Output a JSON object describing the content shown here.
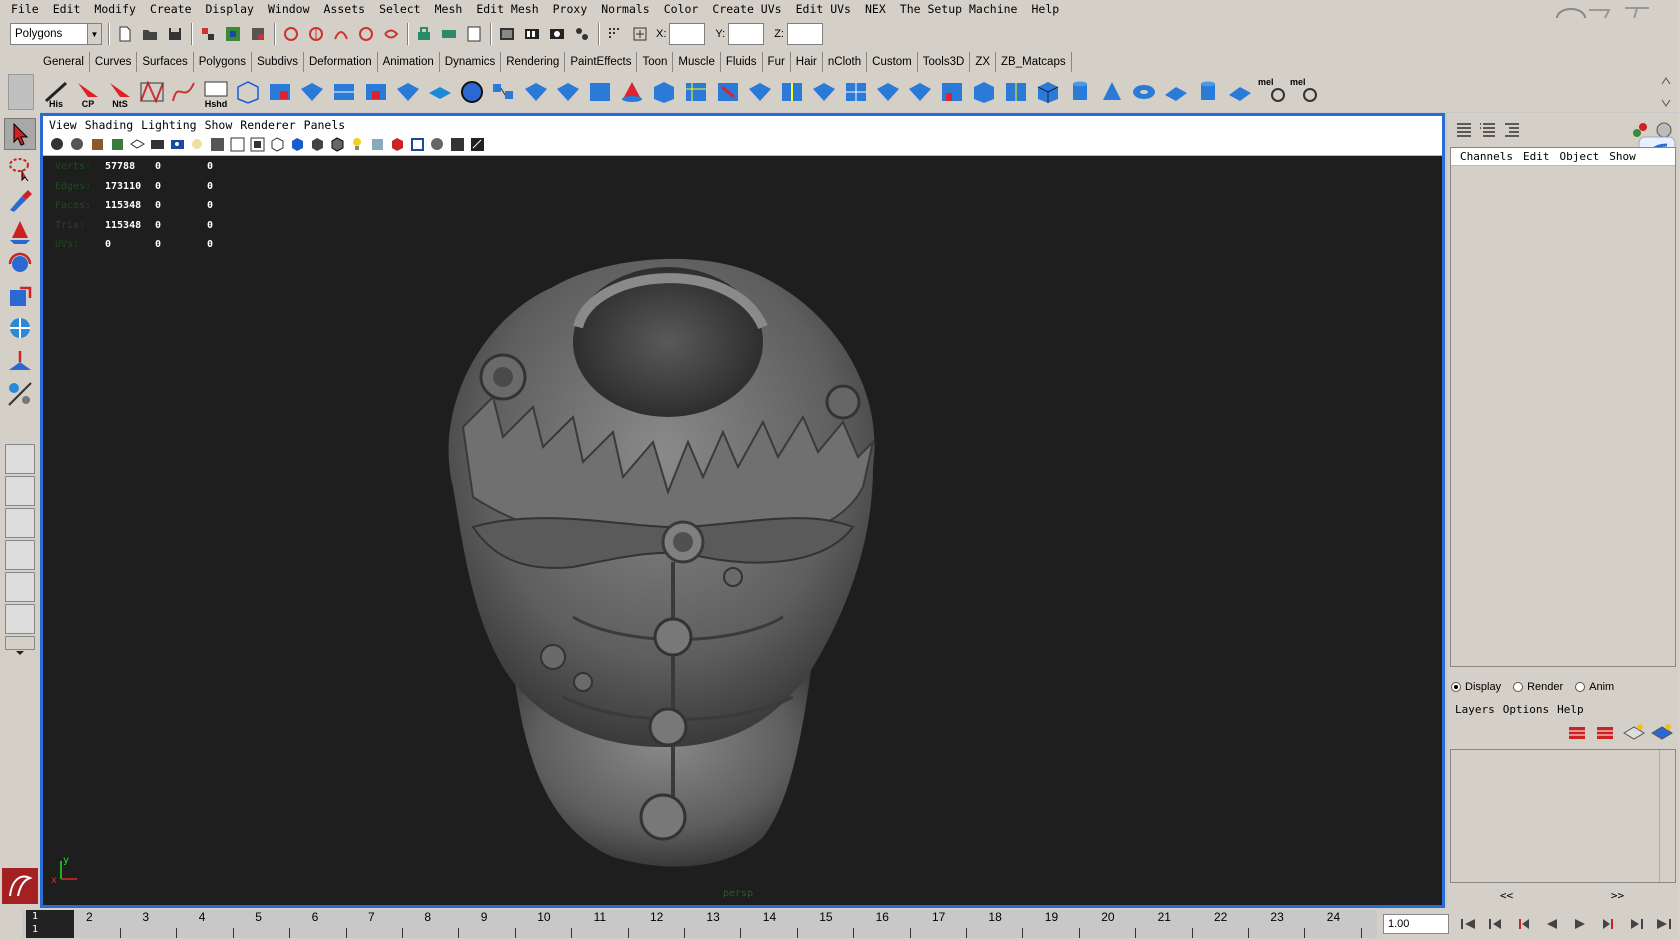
{
  "menubar": [
    "File",
    "Edit",
    "Modify",
    "Create",
    "Display",
    "Window",
    "Assets",
    "Select",
    "Mesh",
    "Edit Mesh",
    "Proxy",
    "Normals",
    "Color",
    "Create UVs",
    "Edit UVs",
    "NEX",
    "The Setup Machine",
    "Help"
  ],
  "status": {
    "mode": "Polygons",
    "x_label": "X:",
    "y_label": "Y:",
    "z_label": "Z:"
  },
  "shelf_tabs": [
    "General",
    "Curves",
    "Surfaces",
    "Polygons",
    "Subdivs",
    "Deformation",
    "Animation",
    "Dynamics",
    "Rendering",
    "PaintEffects",
    "Toon",
    "Muscle",
    "Fluids",
    "Fur",
    "Hair",
    "nCloth",
    "Custom",
    "Tools3D",
    "ZX",
    "ZB_Matcaps"
  ],
  "shelf_labels": [
    "His",
    "CP",
    "NtS",
    "Hshd",
    "mel",
    "mel"
  ],
  "viewport": {
    "menu": [
      "View",
      "Shading",
      "Lighting",
      "Show",
      "Renderer",
      "Panels"
    ],
    "hud": [
      {
        "label": "Verts:",
        "values": [
          "57788",
          "0",
          "0"
        ]
      },
      {
        "label": "Edges:",
        "values": [
          "173110",
          "0",
          "0"
        ]
      },
      {
        "label": "Faces:",
        "values": [
          "115348",
          "0",
          "0"
        ]
      },
      {
        "label": "Tris:",
        "values": [
          "115348",
          "0",
          "0"
        ]
      },
      {
        "label": "UVs:",
        "values": [
          "0",
          "0",
          "0"
        ]
      }
    ],
    "axis_y": "y",
    "axis_x": "x",
    "camera": "persp"
  },
  "channel_box": {
    "menu": [
      "Channels",
      "Edit",
      "Object",
      "Show"
    ]
  },
  "layer_editor": {
    "modes": [
      {
        "label": "Display",
        "selected": true
      },
      {
        "label": "Render",
        "selected": false
      },
      {
        "label": "Anim",
        "selected": false
      }
    ],
    "menu": [
      "Layers",
      "Options",
      "Help"
    ],
    "prev": "<<",
    "next": ">>"
  },
  "timeline": {
    "current_frame": "1",
    "current_frame_bottom": "1",
    "ticks": [
      "2",
      "3",
      "4",
      "5",
      "6",
      "7",
      "8",
      "9",
      "10",
      "11",
      "12",
      "13",
      "14",
      "15",
      "16",
      "17",
      "18",
      "19",
      "20",
      "21",
      "22",
      "23",
      "24"
    ],
    "current_time": "1.00"
  },
  "colors": {
    "ui_gray": "#d4d0c8",
    "viewport_bg": "#1e1e1e",
    "active_panel_border": "#2a6cd4",
    "model": "#6e6e6e"
  }
}
